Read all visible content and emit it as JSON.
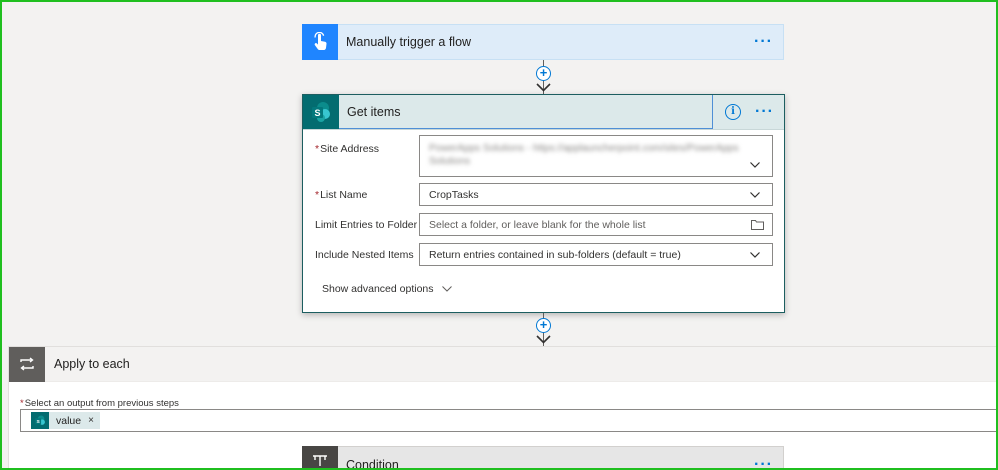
{
  "trigger": {
    "title": "Manually trigger a flow",
    "menu": "···"
  },
  "get_items": {
    "title": "Get items",
    "menu": "···",
    "info": "i",
    "fields": {
      "site_address": {
        "label": "Site Address",
        "required": "*",
        "value_line1": "PowerApps Solutions - https://applauncherpoint.com/sites/PowerApps",
        "value_line2": "Solutions"
      },
      "list_name": {
        "label": "List Name",
        "required": "*",
        "value": "CropTasks"
      },
      "limit_folder": {
        "label": "Limit Entries to Folder",
        "placeholder": "Select a folder, or leave blank for the whole list"
      },
      "nested_items": {
        "label": "Include Nested Items",
        "value": "Return entries contained in sub-folders (default = true)"
      }
    },
    "advanced": "Show advanced options"
  },
  "apply_each": {
    "title": "Apply to each",
    "select_label": "Select an output from previous steps",
    "required": "*",
    "token": {
      "label": "value",
      "remove": "×"
    }
  },
  "condition": {
    "title": "Condition",
    "menu": "···"
  },
  "colors": {
    "accent": "#0078d4",
    "sharepoint": "#036c70",
    "frame": "#1fbf1f",
    "trigger_bg": "#deecf9"
  }
}
